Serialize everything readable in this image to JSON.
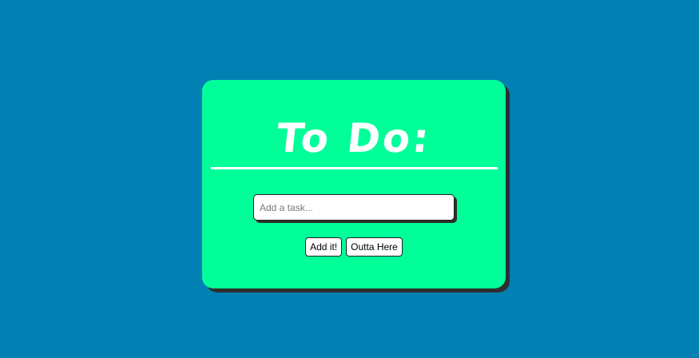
{
  "card": {
    "title": "To Do:",
    "input_placeholder": "Add a task...",
    "input_value": "",
    "add_button_label": "Add it!",
    "remove_button_label": "Outta Here"
  },
  "colors": {
    "page_background": "#0180b4",
    "card_background": "#00ff99",
    "title_color": "#ffffff",
    "shadow": "#2e2e2e"
  }
}
